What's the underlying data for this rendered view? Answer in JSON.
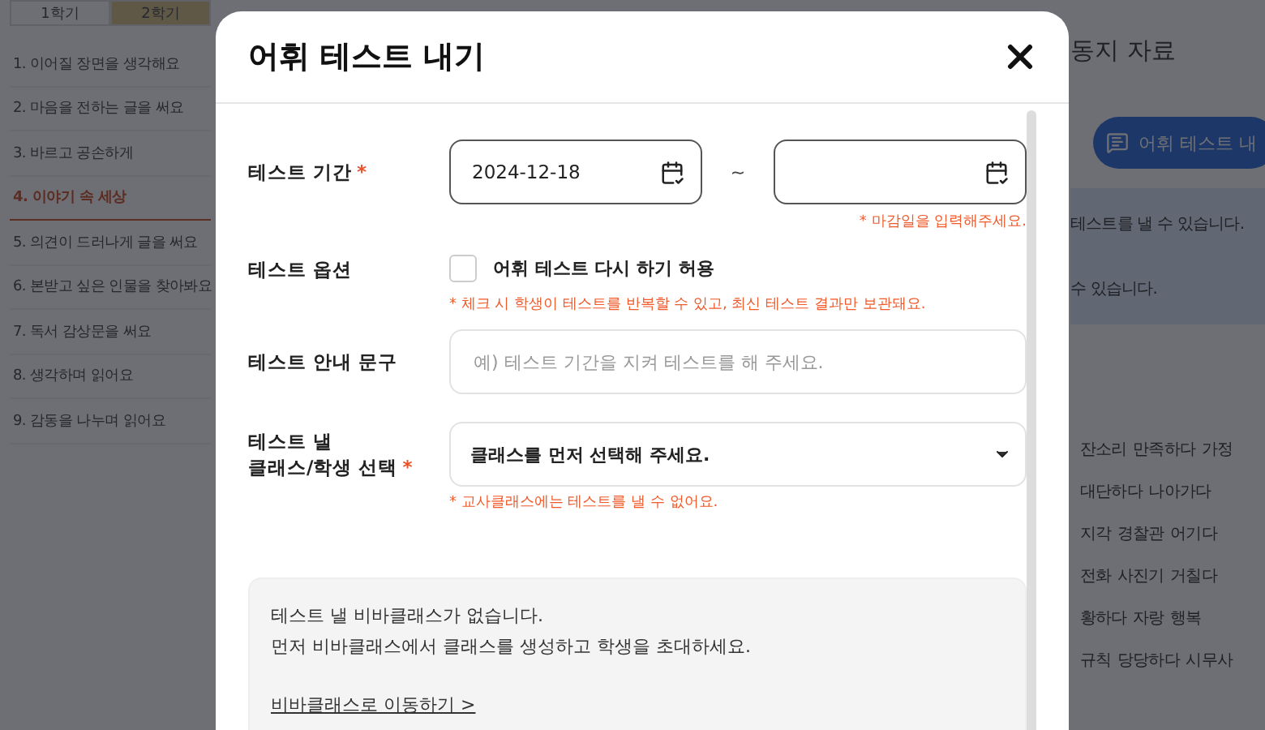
{
  "background": {
    "semester_tabs": [
      {
        "label": "1학기",
        "selected": false
      },
      {
        "label": "2학기",
        "selected": true
      }
    ],
    "lessons": [
      {
        "label": "1. 이어질 장면을 생각해요",
        "selected": false
      },
      {
        "label": "2. 마음을 전하는 글을 써요",
        "selected": false
      },
      {
        "label": "3. 바르고 공손하게",
        "selected": false
      },
      {
        "label": "4. 이야기 속 세상",
        "selected": true
      },
      {
        "label": "5. 의견이 드러나게 글을 써요",
        "selected": false
      },
      {
        "label": "6. 본받고 싶은 인물을 찾아봐요",
        "selected": false
      },
      {
        "label": "7. 독서 감상문을 써요",
        "selected": false
      },
      {
        "label": "8. 생각하며 읽어요",
        "selected": false
      },
      {
        "label": "9. 감동을 나누며 읽어요",
        "selected": false
      }
    ],
    "section_title": "동지 자료",
    "test_button": "어휘 테스트 내",
    "notices": [
      "테스트를 낼 수 있습니다.",
      "수 있습니다."
    ],
    "word_rows": [
      "잔소리 만족하다 가정",
      "대단하다 나아가다",
      "지각 경찰관 어기다",
      "전화 사진기 거칠다",
      "황하다 자랑 행복",
      "규칙 당당하다 시무사"
    ]
  },
  "modal": {
    "title": "어휘 테스트 내기",
    "period": {
      "label": "테스트 기간",
      "required_mark": "*",
      "start_value": "2024-12-18",
      "separator": "~",
      "error": "* 마감일을 입력해주세요."
    },
    "option": {
      "label": "테스트 옵션",
      "checkbox_label": "어휘 테스트 다시 하기 허용",
      "checked": false,
      "note": "* 체크 시 학생이 테스트를 반복할 수 있고, 최신 테스트 결과만 보관돼요."
    },
    "guide": {
      "label": "테스트 안내 문구",
      "placeholder": "예) 테스트 기간을 지켜 테스트를 해 주세요."
    },
    "target": {
      "label_lines": [
        "테스트 낼",
        "클래스/학생 선택"
      ],
      "required_mark": "*",
      "value": "클래스를 먼저 선택해 주세요.",
      "note": "* 교사클래스에는 테스트를 낼 수 없어요."
    },
    "info": {
      "lines": [
        "테스트 낼 비바클래스가 없습니다.",
        "먼저 비바클래스에서 클래스를 생성하고 학생을 초대하세요."
      ],
      "link": "비바클래스로 이동하기 >"
    }
  }
}
